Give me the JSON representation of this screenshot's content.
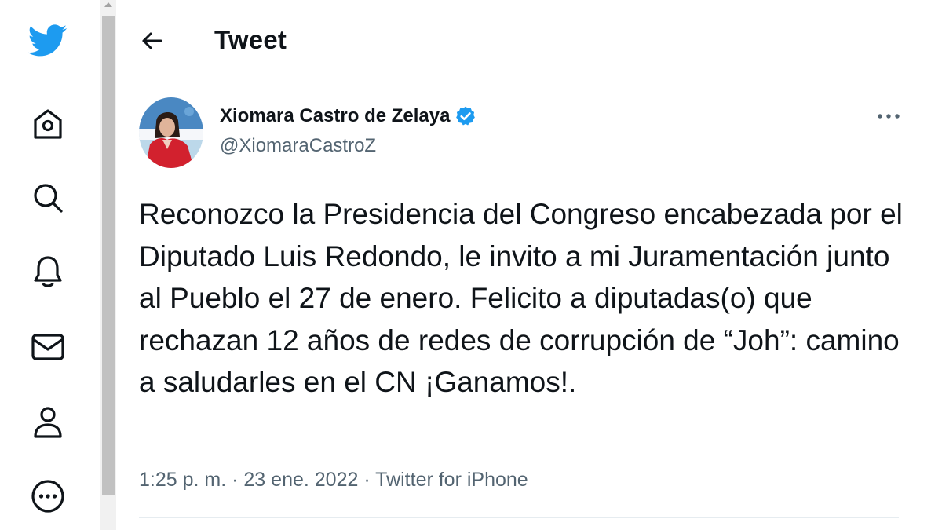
{
  "header": {
    "title": "Tweet"
  },
  "nav": {
    "items": [
      {
        "icon": "twitter-logo-icon"
      },
      {
        "icon": "home-icon"
      },
      {
        "icon": "search-icon"
      },
      {
        "icon": "bell-icon"
      },
      {
        "icon": "mail-icon"
      },
      {
        "icon": "profile-icon"
      },
      {
        "icon": "more-circle-icon"
      }
    ]
  },
  "colors": {
    "brand": "#1d9bf0",
    "text": "#0f1419",
    "secondary": "#536471"
  },
  "tweet": {
    "author_name": "Xiomara Castro de Zelaya",
    "author_handle": "@XiomaraCastroZ",
    "verified": true,
    "text": "Reconozco la Presidencia del Congreso encabezada por el Diputado Luis Redondo, le invito a mi Juramentación junto al Pueblo el 27 de enero. Felicito a diputadas(o) que rechazan 12 años de redes de corrupción de “Joh”: camino a saludarles en el CN ¡Ganamos!.",
    "time": "1:25 p. m.",
    "sep1": "·",
    "date": "23 ene. 2022",
    "sep2": "·",
    "source": "Twitter for iPhone"
  }
}
